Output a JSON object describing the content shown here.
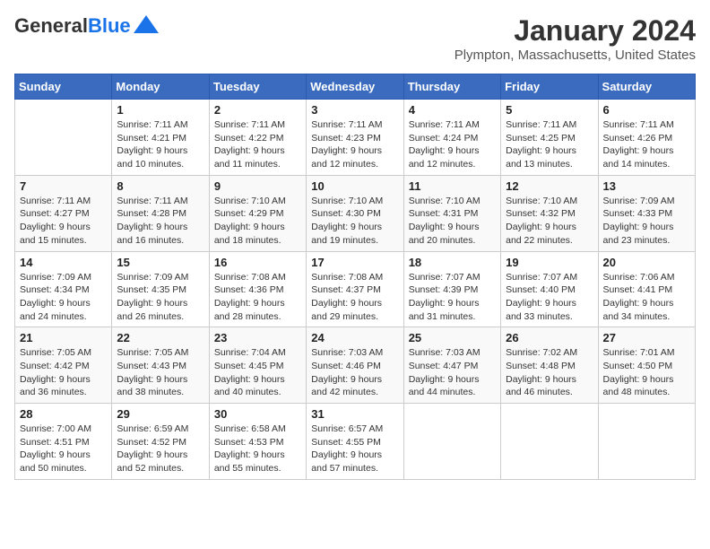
{
  "logo": {
    "general": "General",
    "blue": "Blue"
  },
  "title": "January 2024",
  "location": "Plympton, Massachusetts, United States",
  "days_of_week": [
    "Sunday",
    "Monday",
    "Tuesday",
    "Wednesday",
    "Thursday",
    "Friday",
    "Saturday"
  ],
  "weeks": [
    [
      {
        "day": "",
        "sunrise": "",
        "sunset": "",
        "daylight": ""
      },
      {
        "day": "1",
        "sunrise": "Sunrise: 7:11 AM",
        "sunset": "Sunset: 4:21 PM",
        "daylight": "Daylight: 9 hours and 10 minutes."
      },
      {
        "day": "2",
        "sunrise": "Sunrise: 7:11 AM",
        "sunset": "Sunset: 4:22 PM",
        "daylight": "Daylight: 9 hours and 11 minutes."
      },
      {
        "day": "3",
        "sunrise": "Sunrise: 7:11 AM",
        "sunset": "Sunset: 4:23 PM",
        "daylight": "Daylight: 9 hours and 12 minutes."
      },
      {
        "day": "4",
        "sunrise": "Sunrise: 7:11 AM",
        "sunset": "Sunset: 4:24 PM",
        "daylight": "Daylight: 9 hours and 12 minutes."
      },
      {
        "day": "5",
        "sunrise": "Sunrise: 7:11 AM",
        "sunset": "Sunset: 4:25 PM",
        "daylight": "Daylight: 9 hours and 13 minutes."
      },
      {
        "day": "6",
        "sunrise": "Sunrise: 7:11 AM",
        "sunset": "Sunset: 4:26 PM",
        "daylight": "Daylight: 9 hours and 14 minutes."
      }
    ],
    [
      {
        "day": "7",
        "sunrise": "Sunrise: 7:11 AM",
        "sunset": "Sunset: 4:27 PM",
        "daylight": "Daylight: 9 hours and 15 minutes."
      },
      {
        "day": "8",
        "sunrise": "Sunrise: 7:11 AM",
        "sunset": "Sunset: 4:28 PM",
        "daylight": "Daylight: 9 hours and 16 minutes."
      },
      {
        "day": "9",
        "sunrise": "Sunrise: 7:10 AM",
        "sunset": "Sunset: 4:29 PM",
        "daylight": "Daylight: 9 hours and 18 minutes."
      },
      {
        "day": "10",
        "sunrise": "Sunrise: 7:10 AM",
        "sunset": "Sunset: 4:30 PM",
        "daylight": "Daylight: 9 hours and 19 minutes."
      },
      {
        "day": "11",
        "sunrise": "Sunrise: 7:10 AM",
        "sunset": "Sunset: 4:31 PM",
        "daylight": "Daylight: 9 hours and 20 minutes."
      },
      {
        "day": "12",
        "sunrise": "Sunrise: 7:10 AM",
        "sunset": "Sunset: 4:32 PM",
        "daylight": "Daylight: 9 hours and 22 minutes."
      },
      {
        "day": "13",
        "sunrise": "Sunrise: 7:09 AM",
        "sunset": "Sunset: 4:33 PM",
        "daylight": "Daylight: 9 hours and 23 minutes."
      }
    ],
    [
      {
        "day": "14",
        "sunrise": "Sunrise: 7:09 AM",
        "sunset": "Sunset: 4:34 PM",
        "daylight": "Daylight: 9 hours and 24 minutes."
      },
      {
        "day": "15",
        "sunrise": "Sunrise: 7:09 AM",
        "sunset": "Sunset: 4:35 PM",
        "daylight": "Daylight: 9 hours and 26 minutes."
      },
      {
        "day": "16",
        "sunrise": "Sunrise: 7:08 AM",
        "sunset": "Sunset: 4:36 PM",
        "daylight": "Daylight: 9 hours and 28 minutes."
      },
      {
        "day": "17",
        "sunrise": "Sunrise: 7:08 AM",
        "sunset": "Sunset: 4:37 PM",
        "daylight": "Daylight: 9 hours and 29 minutes."
      },
      {
        "day": "18",
        "sunrise": "Sunrise: 7:07 AM",
        "sunset": "Sunset: 4:39 PM",
        "daylight": "Daylight: 9 hours and 31 minutes."
      },
      {
        "day": "19",
        "sunrise": "Sunrise: 7:07 AM",
        "sunset": "Sunset: 4:40 PM",
        "daylight": "Daylight: 9 hours and 33 minutes."
      },
      {
        "day": "20",
        "sunrise": "Sunrise: 7:06 AM",
        "sunset": "Sunset: 4:41 PM",
        "daylight": "Daylight: 9 hours and 34 minutes."
      }
    ],
    [
      {
        "day": "21",
        "sunrise": "Sunrise: 7:05 AM",
        "sunset": "Sunset: 4:42 PM",
        "daylight": "Daylight: 9 hours and 36 minutes."
      },
      {
        "day": "22",
        "sunrise": "Sunrise: 7:05 AM",
        "sunset": "Sunset: 4:43 PM",
        "daylight": "Daylight: 9 hours and 38 minutes."
      },
      {
        "day": "23",
        "sunrise": "Sunrise: 7:04 AM",
        "sunset": "Sunset: 4:45 PM",
        "daylight": "Daylight: 9 hours and 40 minutes."
      },
      {
        "day": "24",
        "sunrise": "Sunrise: 7:03 AM",
        "sunset": "Sunset: 4:46 PM",
        "daylight": "Daylight: 9 hours and 42 minutes."
      },
      {
        "day": "25",
        "sunrise": "Sunrise: 7:03 AM",
        "sunset": "Sunset: 4:47 PM",
        "daylight": "Daylight: 9 hours and 44 minutes."
      },
      {
        "day": "26",
        "sunrise": "Sunrise: 7:02 AM",
        "sunset": "Sunset: 4:48 PM",
        "daylight": "Daylight: 9 hours and 46 minutes."
      },
      {
        "day": "27",
        "sunrise": "Sunrise: 7:01 AM",
        "sunset": "Sunset: 4:50 PM",
        "daylight": "Daylight: 9 hours and 48 minutes."
      }
    ],
    [
      {
        "day": "28",
        "sunrise": "Sunrise: 7:00 AM",
        "sunset": "Sunset: 4:51 PM",
        "daylight": "Daylight: 9 hours and 50 minutes."
      },
      {
        "day": "29",
        "sunrise": "Sunrise: 6:59 AM",
        "sunset": "Sunset: 4:52 PM",
        "daylight": "Daylight: 9 hours and 52 minutes."
      },
      {
        "day": "30",
        "sunrise": "Sunrise: 6:58 AM",
        "sunset": "Sunset: 4:53 PM",
        "daylight": "Daylight: 9 hours and 55 minutes."
      },
      {
        "day": "31",
        "sunrise": "Sunrise: 6:57 AM",
        "sunset": "Sunset: 4:55 PM",
        "daylight": "Daylight: 9 hours and 57 minutes."
      },
      {
        "day": "",
        "sunrise": "",
        "sunset": "",
        "daylight": ""
      },
      {
        "day": "",
        "sunrise": "",
        "sunset": "",
        "daylight": ""
      },
      {
        "day": "",
        "sunrise": "",
        "sunset": "",
        "daylight": ""
      }
    ]
  ]
}
